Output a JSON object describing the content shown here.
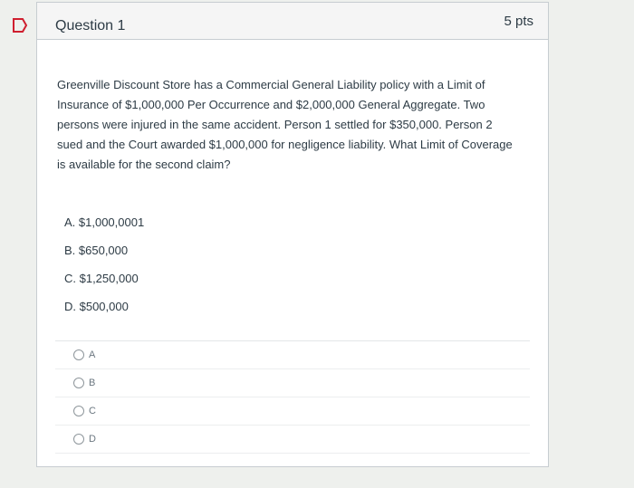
{
  "question": {
    "title": "Question 1",
    "points": "5 pts",
    "text": "Greenville Discount Store has a Commercial General Liability policy with a Limit of Insurance of $1,000,000 Per Occurrence and $2,000,000 General Aggregate. Two persons were injured in the same accident. Person 1 settled for $350,000. Person 2 sued and the Court awarded $1,000,000 for negligence liability. What Limit of Coverage is available for the second claim?",
    "choices": [
      "A. $1,000,0001",
      "B. $650,000",
      "C. $1,250,000",
      "D. $500,000"
    ],
    "answers": [
      "A",
      "B",
      "C",
      "D"
    ]
  },
  "colors": {
    "accent": "#2d3b45",
    "flag": "#cf1f2f"
  },
  "icons": {
    "flag": "bookmark-flag-icon",
    "radio": "radio-button-icon"
  }
}
